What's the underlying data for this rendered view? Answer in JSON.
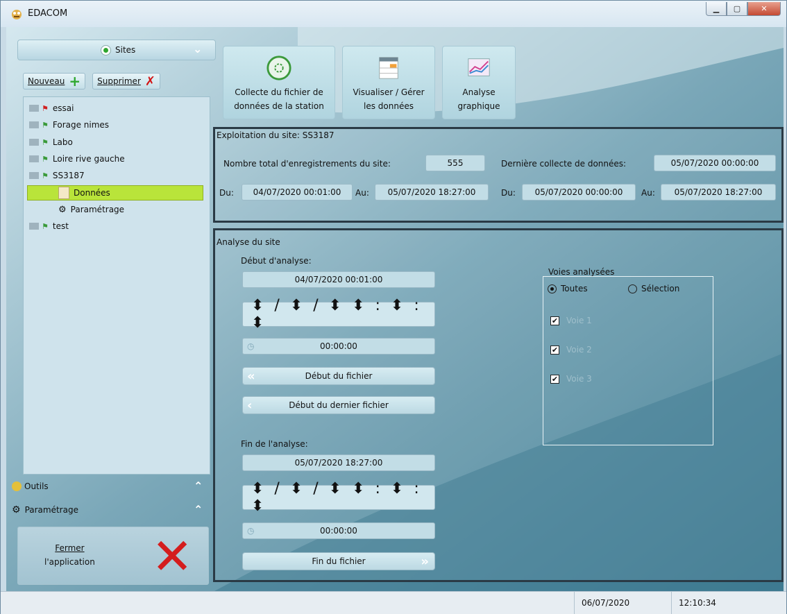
{
  "window": {
    "title": "EDACOM",
    "min_icon": "minimize-icon",
    "max_icon": "maximize-icon",
    "close_icon": "close-icon"
  },
  "sidebar": {
    "sites_label": "Sites",
    "new_label": "Nouveau",
    "delete_label": "Supprimer",
    "tree": [
      {
        "label": "essai",
        "flag": "red"
      },
      {
        "label": "Forage nimes",
        "flag": "green"
      },
      {
        "label": "Labo",
        "flag": "green"
      },
      {
        "label": "Loire rive gauche",
        "flag": "green"
      },
      {
        "label": "SS3187",
        "flag": "green"
      },
      {
        "label": "Données",
        "child": true,
        "selected": true
      },
      {
        "label": "Paramétrage",
        "child": true
      },
      {
        "label": "test",
        "flag": "green"
      }
    ],
    "tools_label": "Outils",
    "settings_label": "Paramétrage",
    "close_app_line1": "Fermer",
    "close_app_line2": "l'application"
  },
  "toolbar": {
    "collect": {
      "line1": "Collecte du fichier de",
      "line2": "données de la station"
    },
    "view": {
      "line1": "Visualiser / Gérer",
      "line2": "les données"
    },
    "analyse": {
      "line1": "Analyse",
      "line2": "graphique"
    }
  },
  "exploitation": {
    "title": "Exploitation du site: SS3187",
    "total_label": "Nombre total d'enregistrements du site:",
    "total_value": "555",
    "last_label": "Dernière collecte de données:",
    "last_value": "05/07/2020 00:00:00",
    "du1_label": "Du:",
    "du1_value": "04/07/2020 00:01:00",
    "au1_label": "Au:",
    "au1_value": "05/07/2020 18:27:00",
    "du2_label": "Du:",
    "du2_value": "05/07/2020 00:00:00",
    "au2_label": "Au:",
    "au2_value": "05/07/2020 18:27:00"
  },
  "analyse": {
    "title": "Analyse du site",
    "start_label": "Début d'analyse:",
    "start_value": "04/07/2020 00:01:00",
    "spin_text": "⬍ / ⬍ / ⬍   ⬍ : ⬍ : ⬍",
    "start_duration": "00:00:00",
    "btn_file_start": "Début du fichier",
    "btn_last_file_start": "Début du dernier fichier",
    "end_label": "Fin de l'analyse:",
    "end_value": "05/07/2020 18:27:00",
    "end_duration": "00:00:00",
    "btn_file_end": "Fin du fichier",
    "voies_title": "Voies analysées",
    "radio_all": "Toutes",
    "radio_selection": "Sélection",
    "voies": [
      "Voie 1",
      "Voie 2",
      "Voie 3"
    ]
  },
  "status": {
    "date": "06/07/2020",
    "time": "12:10:34"
  }
}
